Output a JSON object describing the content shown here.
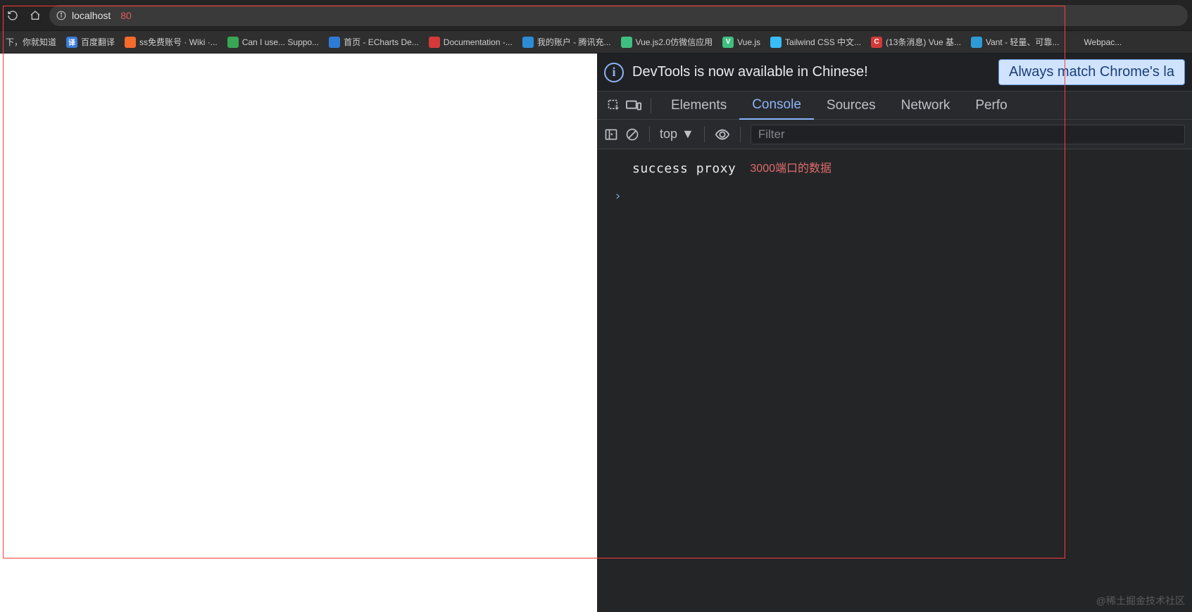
{
  "address": {
    "host": "localhost",
    "port": "80"
  },
  "bookmarks": [
    {
      "label": "下，你就知道",
      "color": ""
    },
    {
      "label": "百度翻译",
      "color": "#3b7bd6"
    },
    {
      "label": "ss免费账号 · Wiki ·...",
      "color": "#f46b2b"
    },
    {
      "label": "Can I use... Suppo...",
      "color": "#3aa655"
    },
    {
      "label": "首页 - ECharts De...",
      "color": "#2e7bd6"
    },
    {
      "label": "Documentation -...",
      "color": "#d43a3a"
    },
    {
      "label": "我的账户 - 腾讯充...",
      "color": "#2d8cd6"
    },
    {
      "label": "Vue.js2.0仿微信应用",
      "color": "#3fbf7f"
    },
    {
      "label": "Vue.js",
      "color": "#3fbf7f"
    },
    {
      "label": "Tailwind CSS 中文...",
      "color": "#38bdf8"
    },
    {
      "label": "(13条消息) Vue 基...",
      "color": "#d43a3a"
    },
    {
      "label": "Vant - 轻量、可靠...",
      "color": "#2e9bd6"
    },
    {
      "label": "Webpac...",
      "color": "#8ed6f8"
    }
  ],
  "infobar": {
    "text": "DevTools is now available in Chinese!",
    "button": "Always match Chrome's la"
  },
  "tabs": {
    "elements": "Elements",
    "console": "Console",
    "sources": "Sources",
    "network": "Network",
    "performance": "Perfo"
  },
  "consoleToolbar": {
    "context": "top",
    "filter_placeholder": "Filter"
  },
  "consoleLog": {
    "message": "success proxy",
    "annotation": "3000端口的数据"
  },
  "watermark": "@稀土掘金技术社区"
}
